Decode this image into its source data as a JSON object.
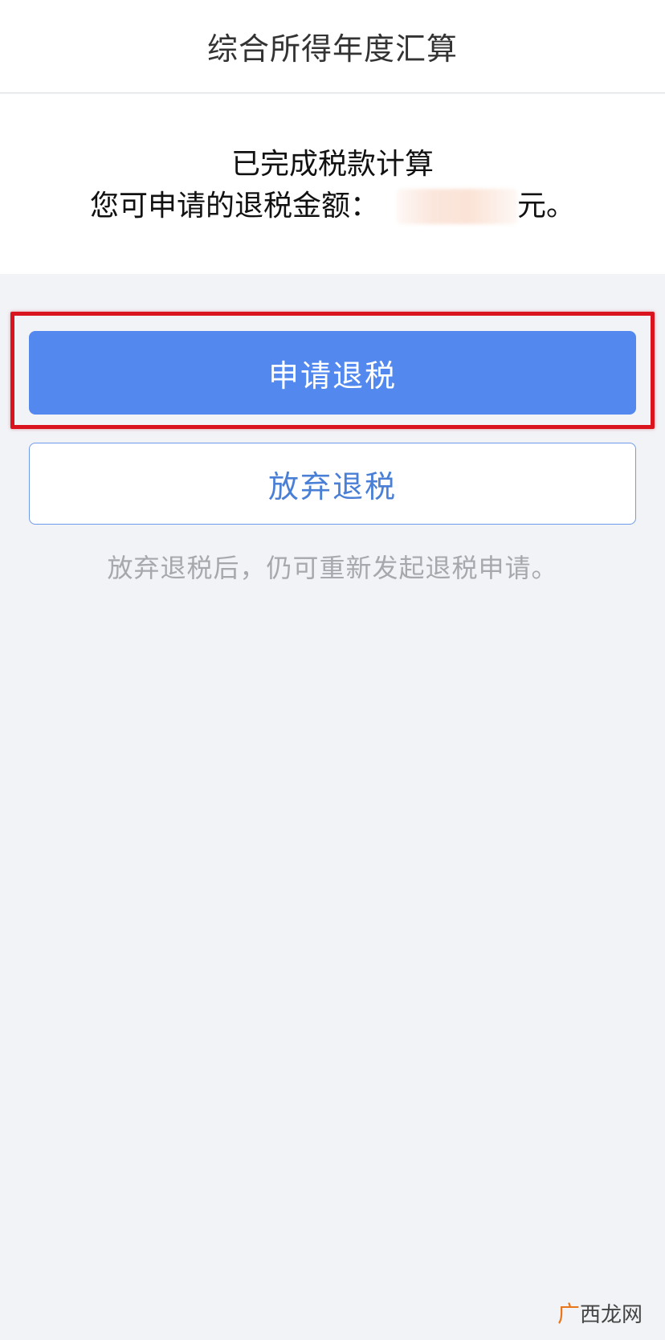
{
  "header": {
    "title": "综合所得年度汇算"
  },
  "result": {
    "status": "已完成税款计算",
    "refund_label": "您可申请的退税金额：",
    "refund_unit": "元。"
  },
  "actions": {
    "apply_label": "申请退税",
    "give_up_label": "放弃退税"
  },
  "hint": "放弃退税后，仍可重新发起退税申请。",
  "watermark": {
    "mark": "广",
    "text": "西龙网"
  },
  "colors": {
    "primary": "#5389ef",
    "highlight": "#d9141e",
    "background": "#f2f3f7"
  }
}
